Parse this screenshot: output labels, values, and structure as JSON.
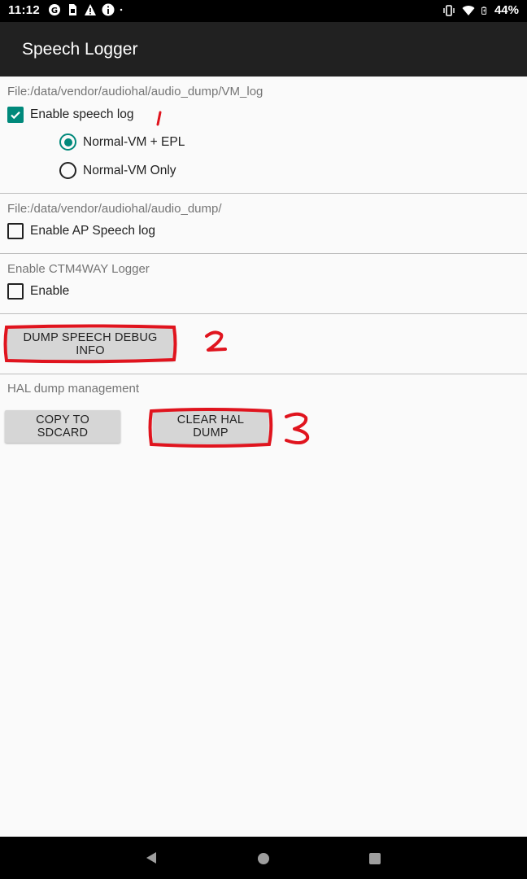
{
  "status_bar": {
    "time": "11:12",
    "battery_percent": "44%",
    "icons_left": [
      "sync-icon",
      "sim-icon",
      "warning-icon",
      "info-icon",
      "dot-icon"
    ],
    "icons_right": [
      "vibrate-icon",
      "wifi-icon",
      "battery-icon"
    ]
  },
  "app_bar": {
    "title": "Speech Logger"
  },
  "sections": {
    "vm_log": {
      "path_label": "File:/data/vendor/audiohal/audio_dump/VM_log",
      "checkbox_label": "Enable speech log",
      "checked": true,
      "radio_options": [
        {
          "label": "Normal-VM + EPL",
          "selected": true
        },
        {
          "label": "Normal-VM Only",
          "selected": false
        }
      ]
    },
    "ap_log": {
      "path_label": "File:/data/vendor/audiohal/audio_dump/",
      "checkbox_label": "Enable AP Speech log",
      "checked": false
    },
    "ctm": {
      "section_label": "Enable CTM4WAY Logger",
      "checkbox_label": "Enable",
      "checked": false
    },
    "debug": {
      "button_label": "DUMP SPEECH DEBUG INFO"
    },
    "hal": {
      "section_label": "HAL dump management",
      "copy_button_label": "COPY TO SDCARD",
      "clear_button_label": "CLEAR HAL DUMP"
    }
  },
  "annotations": [
    "1",
    "2",
    "3"
  ],
  "colors": {
    "accent": "#00897b",
    "annotation": "#e0141e",
    "app_bar": "#212121"
  }
}
